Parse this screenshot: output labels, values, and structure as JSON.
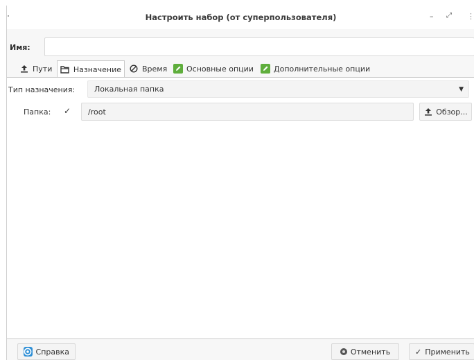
{
  "window": {
    "title": "Настроить набор (от суперпользователя)",
    "controls": {
      "minimize": "–",
      "maximize": "⤢",
      "close": "⋮"
    }
  },
  "name_field": {
    "label": "Имя:",
    "value": ""
  },
  "tabs": [
    {
      "label": "Пути",
      "icon": "upload-icon",
      "active": false
    },
    {
      "label": "Назначение",
      "icon": "folder-icon",
      "active": true
    },
    {
      "label": "Время",
      "icon": "clock-icon",
      "active": false
    },
    {
      "label": "Основные опции",
      "icon": "edit-icon",
      "active": false
    },
    {
      "label": "Дополнительные опции",
      "icon": "edit-icon",
      "active": false
    }
  ],
  "destination": {
    "type_label": "Тип назначения:",
    "type_value": "Локальная папка",
    "folder_label": "Папка:",
    "folder_value": "/root",
    "browse_label": "Обзор..."
  },
  "footer": {
    "help_label": "Справка",
    "cancel_label": "Отменить",
    "apply_label": "Применить"
  },
  "colors": {
    "accent_green": "#5fae3c",
    "help_blue": "#2e8fd6"
  }
}
